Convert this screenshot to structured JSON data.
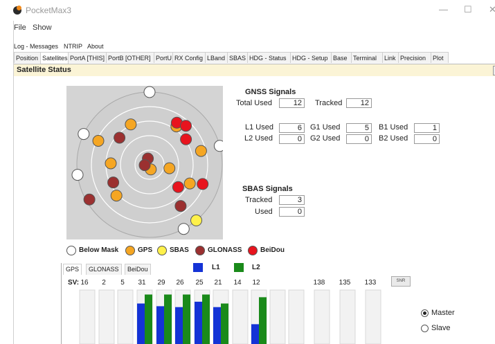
{
  "window": {
    "title": "PocketMax3",
    "minimize": "—",
    "maximize": "☐",
    "close": "✕"
  },
  "menu": {
    "file": "File",
    "show": "Show"
  },
  "tabs_row1": [
    "Log - Messages",
    "NTRIP",
    "About"
  ],
  "tabs_row2": [
    "Position",
    "Satellites",
    "PortA [THIS]",
    "PortB [OTHER]",
    "PortU",
    "RX Config",
    "LBand",
    "SBAS",
    "HDG - Status",
    "HDG - Setup",
    "Base",
    "Terminal",
    "Link",
    "Precision",
    "Plot"
  ],
  "active_tab": "Satellites",
  "section": {
    "title": "Satellite Status"
  },
  "gnss": {
    "title": "GNSS Signals",
    "total_used_label": "Total Used",
    "total_used": "12",
    "tracked_label": "Tracked",
    "tracked": "12",
    "l1_used_label": "L1 Used",
    "l1_used": "6",
    "l2_used_label": "L2 Used",
    "l2_used": "0",
    "g1_used_label": "G1 Used",
    "g1_used": "5",
    "g2_used_label": "G2 Used",
    "g2_used": "0",
    "b1_used_label": "B1 Used",
    "b1_used": "1",
    "b2_used_label": "B2 Used",
    "b2_used": "0"
  },
  "sbas": {
    "title": "SBAS Signals",
    "tracked_label": "Tracked",
    "tracked": "3",
    "used_label": "Used",
    "used": "0"
  },
  "legend": [
    "Below Mask",
    "GPS",
    "SBAS",
    "GLONASS",
    "BeiDou"
  ],
  "colors": {
    "below_mask": "#ffffff",
    "gps": "#f5a623",
    "sbas": "#fff14a",
    "glonass": "#9b3030",
    "beidou": "#e8141e",
    "l1": "#1433d6",
    "l2": "#1a8a1a",
    "plot_bg": "#d4d4d4"
  },
  "signal_tabs": [
    "GPS",
    "GLONASS",
    "BeiDou"
  ],
  "signal_legend": {
    "l1": "L1",
    "l2": "L2"
  },
  "sv_label": "SV:",
  "snr_button": "SNR",
  "mode": {
    "master": "Master",
    "slave": "Slave",
    "selected": "Master"
  },
  "skyplot_satellites": [
    {
      "type": "below_mask",
      "az": 0,
      "el": 0
    },
    {
      "type": "below_mask",
      "az": 295,
      "el": 0
    },
    {
      "type": "below_mask",
      "az": 75,
      "el": 0
    },
    {
      "type": "below_mask",
      "az": 262,
      "el": 0
    },
    {
      "type": "below_mask",
      "az": 152,
      "el": 0
    },
    {
      "type": "gps",
      "az": 35,
      "el": 32
    },
    {
      "type": "beidou",
      "az": 33,
      "el": 28
    },
    {
      "type": "beidou",
      "az": 43,
      "el": 24
    },
    {
      "type": "gps",
      "az": 295,
      "el": 20
    },
    {
      "type": "glonass",
      "az": 312,
      "el": 40
    },
    {
      "type": "gps",
      "az": 335,
      "el": 35
    },
    {
      "type": "beidou",
      "az": 55,
      "el": 35
    },
    {
      "type": "gps",
      "az": 75,
      "el": 24
    },
    {
      "type": "glonass",
      "az": 345,
      "el": 82
    },
    {
      "type": "gps",
      "az": 165,
      "el": 84
    },
    {
      "type": "gps",
      "az": 272,
      "el": 42
    },
    {
      "type": "glonass",
      "az": 244,
      "el": 40
    },
    {
      "type": "glonass",
      "az": 265,
      "el": 84
    },
    {
      "type": "gps",
      "az": 100,
      "el": 65
    },
    {
      "type": "beidou",
      "az": 110,
      "el": 20
    },
    {
      "type": "gps",
      "az": 115,
      "el": 35
    },
    {
      "type": "beidou",
      "az": 128,
      "el": 45
    },
    {
      "type": "glonass",
      "az": 143,
      "el": 26
    },
    {
      "type": "gps",
      "az": 227,
      "el": 34
    },
    {
      "type": "glonass",
      "az": 240,
      "el": 4
    },
    {
      "type": "sbas",
      "az": 140,
      "el": 0
    }
  ],
  "chart_data": {
    "type": "bar",
    "title": "",
    "categories": [
      "16",
      "2",
      "5",
      "31",
      "29",
      "26",
      "25",
      "21",
      "14",
      "12",
      "",
      "",
      "138",
      "135",
      "133"
    ],
    "series": [
      {
        "name": "L1",
        "values": [
          0,
          0,
          0,
          45,
          42,
          41,
          47,
          41,
          0,
          22,
          0,
          0,
          0,
          0,
          0
        ]
      },
      {
        "name": "L2",
        "values": [
          0,
          0,
          0,
          55,
          55,
          55,
          55,
          45,
          0,
          52,
          0,
          0,
          0,
          0,
          0
        ]
      }
    ],
    "ylim": [
      0,
      60
    ]
  }
}
